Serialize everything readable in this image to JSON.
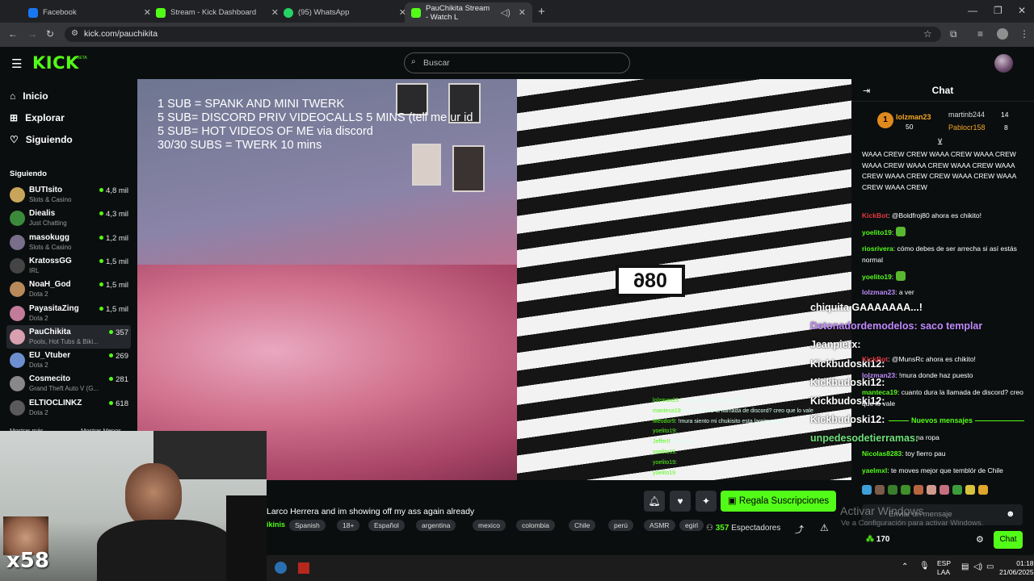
{
  "browser": {
    "tabs": [
      {
        "label": "Facebook",
        "color": "#1877f2"
      },
      {
        "label": "Stream - Kick Dashboard",
        "color": "#53fc18"
      },
      {
        "label": "(95) WhatsApp",
        "color": "#25d366"
      },
      {
        "label": "PauChikita Stream - Watch L",
        "color": "#53fc18"
      }
    ],
    "url": "kick.com/pauchikita"
  },
  "header": {
    "logo": "KICK",
    "beta": "BETA",
    "search_placeholder": "Buscar"
  },
  "nav": [
    {
      "label": "Inicio",
      "icon": "home-icon",
      "glyph": "⌂"
    },
    {
      "label": "Explorar",
      "icon": "compass-icon",
      "glyph": "⊞"
    },
    {
      "label": "Siguiendo",
      "icon": "heart-icon",
      "glyph": "♡"
    }
  ],
  "sidebar": {
    "section": "Siguiendo",
    "channels": [
      {
        "name": "BUTIsito",
        "category": "Slots & Casino",
        "viewers": "4,8 mil",
        "color": "#c9a55c"
      },
      {
        "name": "Diealis",
        "category": "Just Chatting",
        "viewers": "4,3 mil",
        "color": "#3b8a3b"
      },
      {
        "name": "masokugg",
        "category": "Slots & Casino",
        "viewers": "1,2 mil",
        "color": "#7a6f8a"
      },
      {
        "name": "KratossGG",
        "category": "IRL",
        "viewers": "1,5 mil",
        "color": "#444"
      },
      {
        "name": "NoaH_God",
        "category": "Dota 2",
        "viewers": "1,5 mil",
        "color": "#b88a5a"
      },
      {
        "name": "PayasitaZing",
        "category": "Dota 2",
        "viewers": "1,5 mil",
        "color": "#c27b9b"
      },
      {
        "name": "PauChikita",
        "category": "Pools, Hot Tubs & Biki...",
        "viewers": "357",
        "color": "#d9a0b0"
      },
      {
        "name": "EU_Vtuber",
        "category": "Dota 2",
        "viewers": "269",
        "color": "#6d8fd0"
      },
      {
        "name": "Cosmecito",
        "category": "Grand Theft Auto V (G...",
        "viewers": "281",
        "color": "#888"
      },
      {
        "name": "ELTIOCLINKZ",
        "category": "Dota 2",
        "viewers": "618",
        "color": "#5a5a5a"
      }
    ],
    "show_more": "Mostrar más",
    "show_less": "Mostrar Menos"
  },
  "video": {
    "overlay_lines": "1 SUB = SPANK AND MINI TWERK\n5 SUB= DISCORD PRIV VIDEOCALLS 5 MINS (tell me ur id\n5 SUB= HOT VIDEOS OF ME via discord\n30/30 SUBS = TWERK 10 mins",
    "badge": "086",
    "small_chat": [
      {
        "user": "lolzman23",
        "text": "!mura donde haz puesto"
      },
      {
        "user": "manteca19",
        "text": "cuanto dura la llamada de discord? creo que lo vale"
      },
      {
        "user": "Meodor9",
        "text": "!mura siento mi chukisito esta lagrimeando"
      },
      {
        "user": "yoelito19",
        "text": ""
      },
      {
        "user": "JefferII",
        "text": "!puntos"
      },
      {
        "user": "yoelito19",
        "text": ""
      },
      {
        "user": "yoelito19",
        "text": ""
      },
      {
        "user": "yoelito19",
        "text": ""
      }
    ],
    "big_chat": [
      {
        "text": "chiquita GAAAAAAA...!",
        "color": "#ffffff"
      },
      {
        "text": "Detonadordemodelos: saco templar",
        "color": "#c08bff"
      },
      {
        "text": "Jeanpierx:",
        "color": "#ffffff"
      },
      {
        "text": "Kickbudoski12:",
        "color": "#ffffff"
      },
      {
        "text": "Kickbudoski12:",
        "color": "#ffffff"
      },
      {
        "text": "Kickbudoski12:",
        "color": "#ffffff"
      },
      {
        "text": "Kickbudoski12:",
        "color": "#ffffff"
      },
      {
        "text": "unpedesodetierramas:",
        "color": "#6fe07a"
      }
    ]
  },
  "stream_info": {
    "title": "Larco Herrera and im showing off my ass again already",
    "category": "ikinis",
    "tags": [
      "Spanish",
      "18+",
      "Español",
      "argentina",
      "mexico",
      "colombia",
      "Chile",
      "perú",
      "ASMR",
      "egirl"
    ],
    "subs_button": "Regala Suscripciones",
    "viewers_count": "357",
    "viewers_label": "Espectadores"
  },
  "chat": {
    "title": "Chat",
    "leaders": [
      {
        "name": "lolzman23",
        "value": "50"
      },
      {
        "name": "martinb244",
        "value": "14"
      },
      {
        "name": "Pablocr158",
        "value": "8"
      }
    ],
    "crew_text": "WAAA CREW  CREW  WAAA CREW  WAAA CREW  WAAA CREW  WAAA CREW  WAAA CREW  WAAA CREW  WAAA CREW  CREW  WAAA CREW  WAAA CREW  WAAA CREW",
    "messages": [
      {
        "user": "KickBot",
        "text": "@Boldfroj80 ahora es chikito!",
        "color": "#e0383e"
      },
      {
        "user": "yoelito19",
        "text": "",
        "color": "#53fc18"
      },
      {
        "user": "riosrivera",
        "text": "cómo debes de ser arrecha si así estás normal",
        "color": "#53fc18"
      },
      {
        "user": "yoelito19",
        "text": "",
        "color": "#53fc18"
      },
      {
        "user": "lolzman23",
        "text": "a ver",
        "color": "#c08bff"
      },
      {
        "user": "KickBot",
        "text": "@MunsRc ahora es chikito!",
        "color": "#e0383e"
      },
      {
        "user": "lolzman23",
        "text": "!mura donde haz puesto",
        "color": "#c08bff"
      },
      {
        "user": "manteca19",
        "text": "cuanto dura la llamada de discord? creo que lo vale",
        "color": "#53fc18"
      },
      {
        "user": "Nicolas8283",
        "text": "toy fierro pau",
        "color": "#53fc18"
      },
      {
        "user": "yaelmxl",
        "text": "te moves mejor que temblór de Chile",
        "color": "#53fc18"
      }
    ],
    "partial_message": "na ropa",
    "new_messages": "Nuevos mensajes",
    "input_placeholder": "Enviar un mensaje",
    "points": "170",
    "send_label": "Chat"
  },
  "windows": {
    "activate_title": "Activar Windows",
    "activate_sub": "Ve a Configuración para activar Windows.",
    "lang1": "ESP",
    "lang2": "LAA",
    "time": "01:18",
    "date": "21/06/2025"
  },
  "cam": {
    "multiplier": "x58"
  }
}
